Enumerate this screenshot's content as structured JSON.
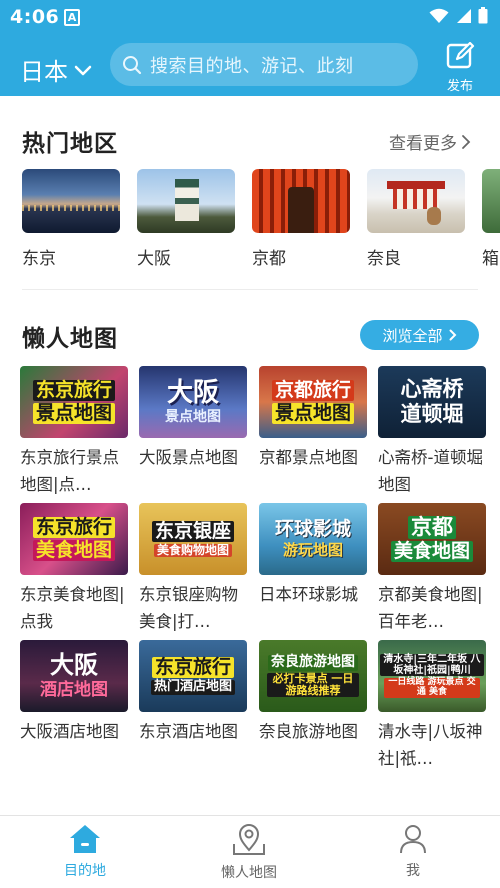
{
  "status_bar": {
    "time": "4:06",
    "notification_badge": "A"
  },
  "header": {
    "region": "日本",
    "search_placeholder": "搜索目的地、游记、此刻",
    "publish_label": "发布",
    "background_color": "#2eaadf"
  },
  "hot_regions": {
    "title": "热门地区",
    "see_more": "查看更多",
    "items": [
      {
        "name": "东京",
        "image": "tokyo-bay-night-photo"
      },
      {
        "name": "大阪",
        "image": "osaka-castle-photo"
      },
      {
        "name": "京都",
        "image": "fushimi-inari-torii-photo"
      },
      {
        "name": "奈良",
        "image": "nara-temple-deer-photo"
      },
      {
        "name": "箱",
        "image": "hakone-photo"
      }
    ]
  },
  "lazy_maps": {
    "title": "懒人地图",
    "browse_all": "浏览全部",
    "items": [
      {
        "line1": "东京旅行",
        "line2": "景点地图",
        "caption": "东京旅行景点地图|点…"
      },
      {
        "line1": "大阪",
        "line2": "景点地图",
        "caption": "大阪景点地图"
      },
      {
        "line1": "京都旅行",
        "line2": "景点地图",
        "caption": "京都景点地图"
      },
      {
        "line1": "心斋桥",
        "line2": "道顿堀",
        "caption": "心斋桥-道顿堀地图"
      },
      {
        "line1": "东京旅行",
        "line2": "美食地图",
        "caption": "东京美食地图|点我"
      },
      {
        "line1": "东京银座",
        "line2": "美食购物地图",
        "caption": "东京银座购物美食|打…"
      },
      {
        "line1": "环球影城",
        "line2": "游玩地图",
        "caption": "日本环球影城"
      },
      {
        "line1": "京都",
        "line2": "美食地图",
        "caption": "京都美食地图|百年老…"
      },
      {
        "line1": "大阪",
        "line2": "酒店地图",
        "caption": "大阪酒店地图"
      },
      {
        "line1": "东京旅行",
        "line2": "热门酒店地图",
        "caption": "东京酒店地图"
      },
      {
        "line1": "奈良旅游地图",
        "line2": "必打卡景点 一日游路线推荐",
        "caption": "奈良旅游地图"
      },
      {
        "line1": "清水寺|三年二年坂 八坂神社|祇园|鸭川",
        "line2": "一日线路 游玩景点 交通 美食",
        "caption": "清水寺|八坂神社|祇…"
      }
    ]
  },
  "bottom_nav": {
    "items": [
      {
        "label": "目的地",
        "icon": "home-icon",
        "active": true
      },
      {
        "label": "懒人地图",
        "icon": "map-pin-icon",
        "active": false
      },
      {
        "label": "我",
        "icon": "person-icon",
        "active": false
      }
    ],
    "active_color": "#2eaadf",
    "inactive_color": "#666666"
  }
}
